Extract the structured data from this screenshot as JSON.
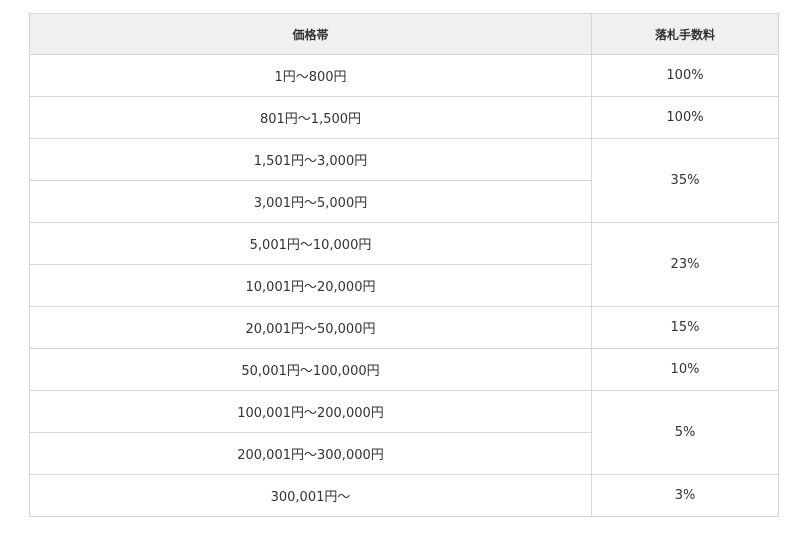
{
  "table": {
    "headers": {
      "price_range": "価格帯",
      "fee": "落札手数料"
    },
    "ranges": [
      "1円〜800円",
      "801円〜1,500円",
      "1,501円〜3,000円",
      "3,001円〜5,000円",
      "5,001円〜10,000円",
      "10,001円〜20,000円",
      "20,001円〜50,000円",
      "50,001円〜100,000円",
      "100,001円〜200,000円",
      "200,001円〜300,000円",
      "300,001円〜"
    ],
    "fees": [
      "100%",
      "100%",
      "35%",
      "23%",
      "15%",
      "10%",
      "5%",
      "3%"
    ]
  }
}
